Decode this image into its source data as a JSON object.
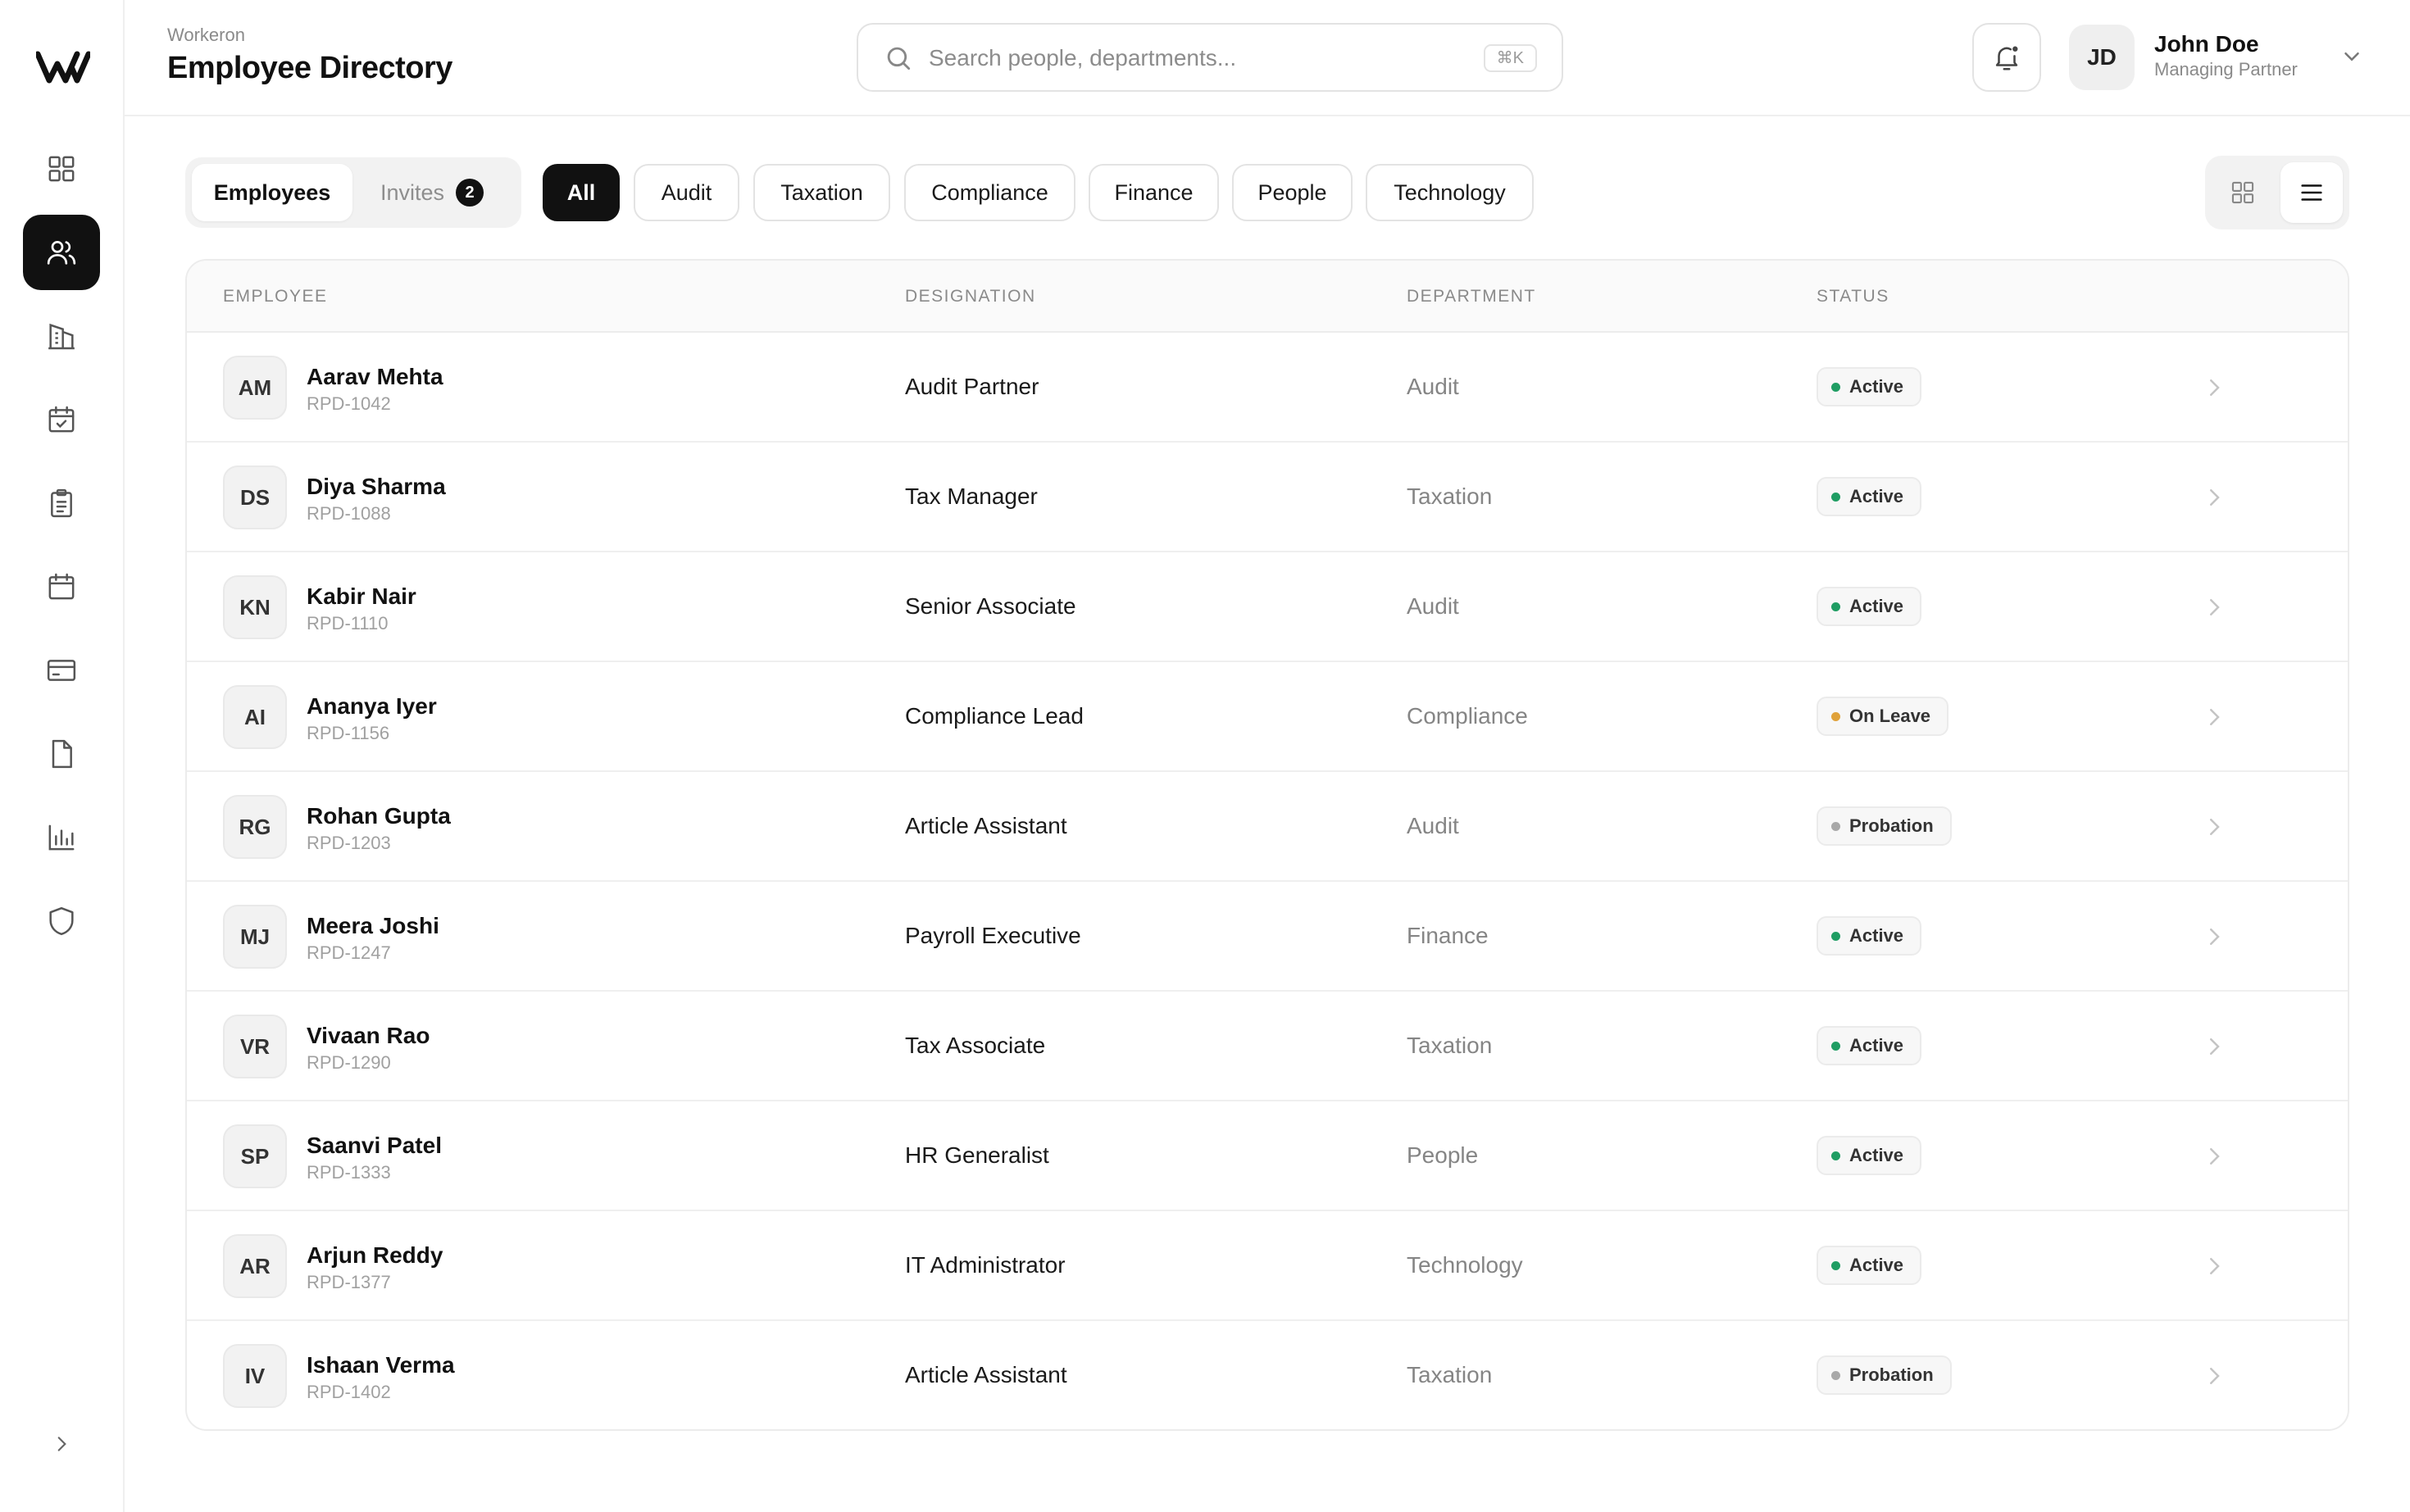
{
  "app": {
    "brand": "Workeron",
    "page_title": "Employee Directory"
  },
  "search": {
    "placeholder": "Search people, departments...",
    "value": "",
    "shortcut": "⌘K"
  },
  "user": {
    "initials": "JD",
    "name": "John Doe",
    "role": "Managing Partner"
  },
  "sidebar": {
    "items": [
      {
        "name": "dashboard",
        "icon": "grid-icon",
        "active": false
      },
      {
        "name": "employees",
        "icon": "users-icon",
        "active": true
      },
      {
        "name": "organization",
        "icon": "building-icon",
        "active": false
      },
      {
        "name": "attendance",
        "icon": "calendar-check-icon",
        "active": false
      },
      {
        "name": "tasks",
        "icon": "clipboard-icon",
        "active": false
      },
      {
        "name": "calendar",
        "icon": "calendar-icon",
        "active": false
      },
      {
        "name": "payroll",
        "icon": "card-icon",
        "active": false
      },
      {
        "name": "documents",
        "icon": "file-icon",
        "active": false
      },
      {
        "name": "reports",
        "icon": "bar-chart-icon",
        "active": false
      },
      {
        "name": "security",
        "icon": "shield-icon",
        "active": false
      }
    ]
  },
  "tabs": {
    "employees": "Employees",
    "invites": "Invites",
    "invites_count": "2"
  },
  "filters": [
    "All",
    "Audit",
    "Taxation",
    "Compliance",
    "Finance",
    "People",
    "Technology"
  ],
  "active_filter": "All",
  "view_mode": "list",
  "table": {
    "headers": {
      "employee": "EMPLOYEE",
      "designation": "DESIGNATION",
      "department": "DEPARTMENT",
      "status": "STATUS"
    },
    "rows": [
      {
        "initials": "AM",
        "name": "Aarav Mehta",
        "id": "RPD-1042",
        "designation": "Audit Partner",
        "department": "Audit",
        "status": "Active"
      },
      {
        "initials": "DS",
        "name": "Diya Sharma",
        "id": "RPD-1088",
        "designation": "Tax Manager",
        "department": "Taxation",
        "status": "Active"
      },
      {
        "initials": "KN",
        "name": "Kabir Nair",
        "id": "RPD-1110",
        "designation": "Senior Associate",
        "department": "Audit",
        "status": "Active"
      },
      {
        "initials": "AI",
        "name": "Ananya Iyer",
        "id": "RPD-1156",
        "designation": "Compliance Lead",
        "department": "Compliance",
        "status": "On Leave"
      },
      {
        "initials": "RG",
        "name": "Rohan Gupta",
        "id": "RPD-1203",
        "designation": "Article Assistant",
        "department": "Audit",
        "status": "Probation"
      },
      {
        "initials": "MJ",
        "name": "Meera Joshi",
        "id": "RPD-1247",
        "designation": "Payroll Executive",
        "department": "Finance",
        "status": "Active"
      },
      {
        "initials": "VR",
        "name": "Vivaan Rao",
        "id": "RPD-1290",
        "designation": "Tax Associate",
        "department": "Taxation",
        "status": "Active"
      },
      {
        "initials": "SP",
        "name": "Saanvi Patel",
        "id": "RPD-1333",
        "designation": "HR Generalist",
        "department": "People",
        "status": "Active"
      },
      {
        "initials": "AR",
        "name": "Arjun Reddy",
        "id": "RPD-1377",
        "designation": "IT Administrator",
        "department": "Technology",
        "status": "Active"
      },
      {
        "initials": "IV",
        "name": "Ishaan Verma",
        "id": "RPD-1402",
        "designation": "Article Assistant",
        "department": "Taxation",
        "status": "Probation"
      }
    ]
  },
  "colors": {
    "active": "#1f9d63",
    "on_leave": "#e0a23a",
    "probation": "#a8a8a8",
    "primary": "#111111"
  }
}
